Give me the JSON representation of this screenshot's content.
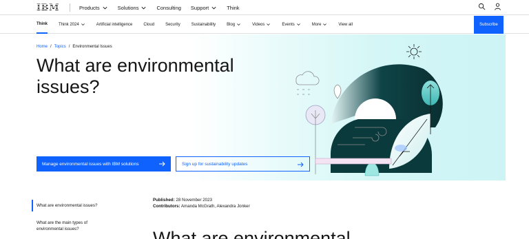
{
  "masthead": {
    "logo": "IBM",
    "nav": [
      {
        "label": "Products",
        "has_menu": true
      },
      {
        "label": "Solutions",
        "has_menu": true
      },
      {
        "label": "Consulting",
        "has_menu": false
      },
      {
        "label": "Support",
        "has_menu": true
      },
      {
        "label": "Think",
        "has_menu": false
      }
    ],
    "icons": [
      "search-icon",
      "user-icon"
    ]
  },
  "subnav": {
    "items": [
      {
        "label": "Think",
        "active": true,
        "has_menu": false
      },
      {
        "label": "Think 2024",
        "has_menu": true
      },
      {
        "label": "Artificial intelligence",
        "has_menu": false
      },
      {
        "label": "Cloud",
        "has_menu": false
      },
      {
        "label": "Security",
        "has_menu": false
      },
      {
        "label": "Sustainability",
        "has_menu": false
      },
      {
        "label": "Blog",
        "has_menu": true
      },
      {
        "label": "Videos",
        "has_menu": true
      },
      {
        "label": "Events",
        "has_menu": true
      },
      {
        "label": "More",
        "has_menu": true
      },
      {
        "label": "View all",
        "has_menu": false
      }
    ],
    "subscribe_label": "Subscribe"
  },
  "hero": {
    "breadcrumb": [
      {
        "label": "Home",
        "link": true
      },
      {
        "label": "Topics",
        "link": true
      },
      {
        "label": "Environmental Issues",
        "link": false
      }
    ],
    "title_line1": "What are environmental",
    "title_line2": "issues?",
    "primary_cta": "Manage environmental issues with IBM solutions",
    "secondary_cta": "Sign up for sustainability updates"
  },
  "toc": {
    "items": [
      {
        "label": "What are environmental issues?",
        "active": true
      },
      {
        "label": "What are the main types of environmental issues?",
        "active": false
      }
    ]
  },
  "article": {
    "published_label": "Published:",
    "published_value": "28 November 2023",
    "contributors_label": "Contributors:",
    "contributors_value": "Amanda McGrath, Alexandra Jonker",
    "title": "What are environmental"
  },
  "colors": {
    "accent": "#0f62fe",
    "hero_bg": "#cdf4f5",
    "illustration_dark": "#0b3a3c"
  }
}
